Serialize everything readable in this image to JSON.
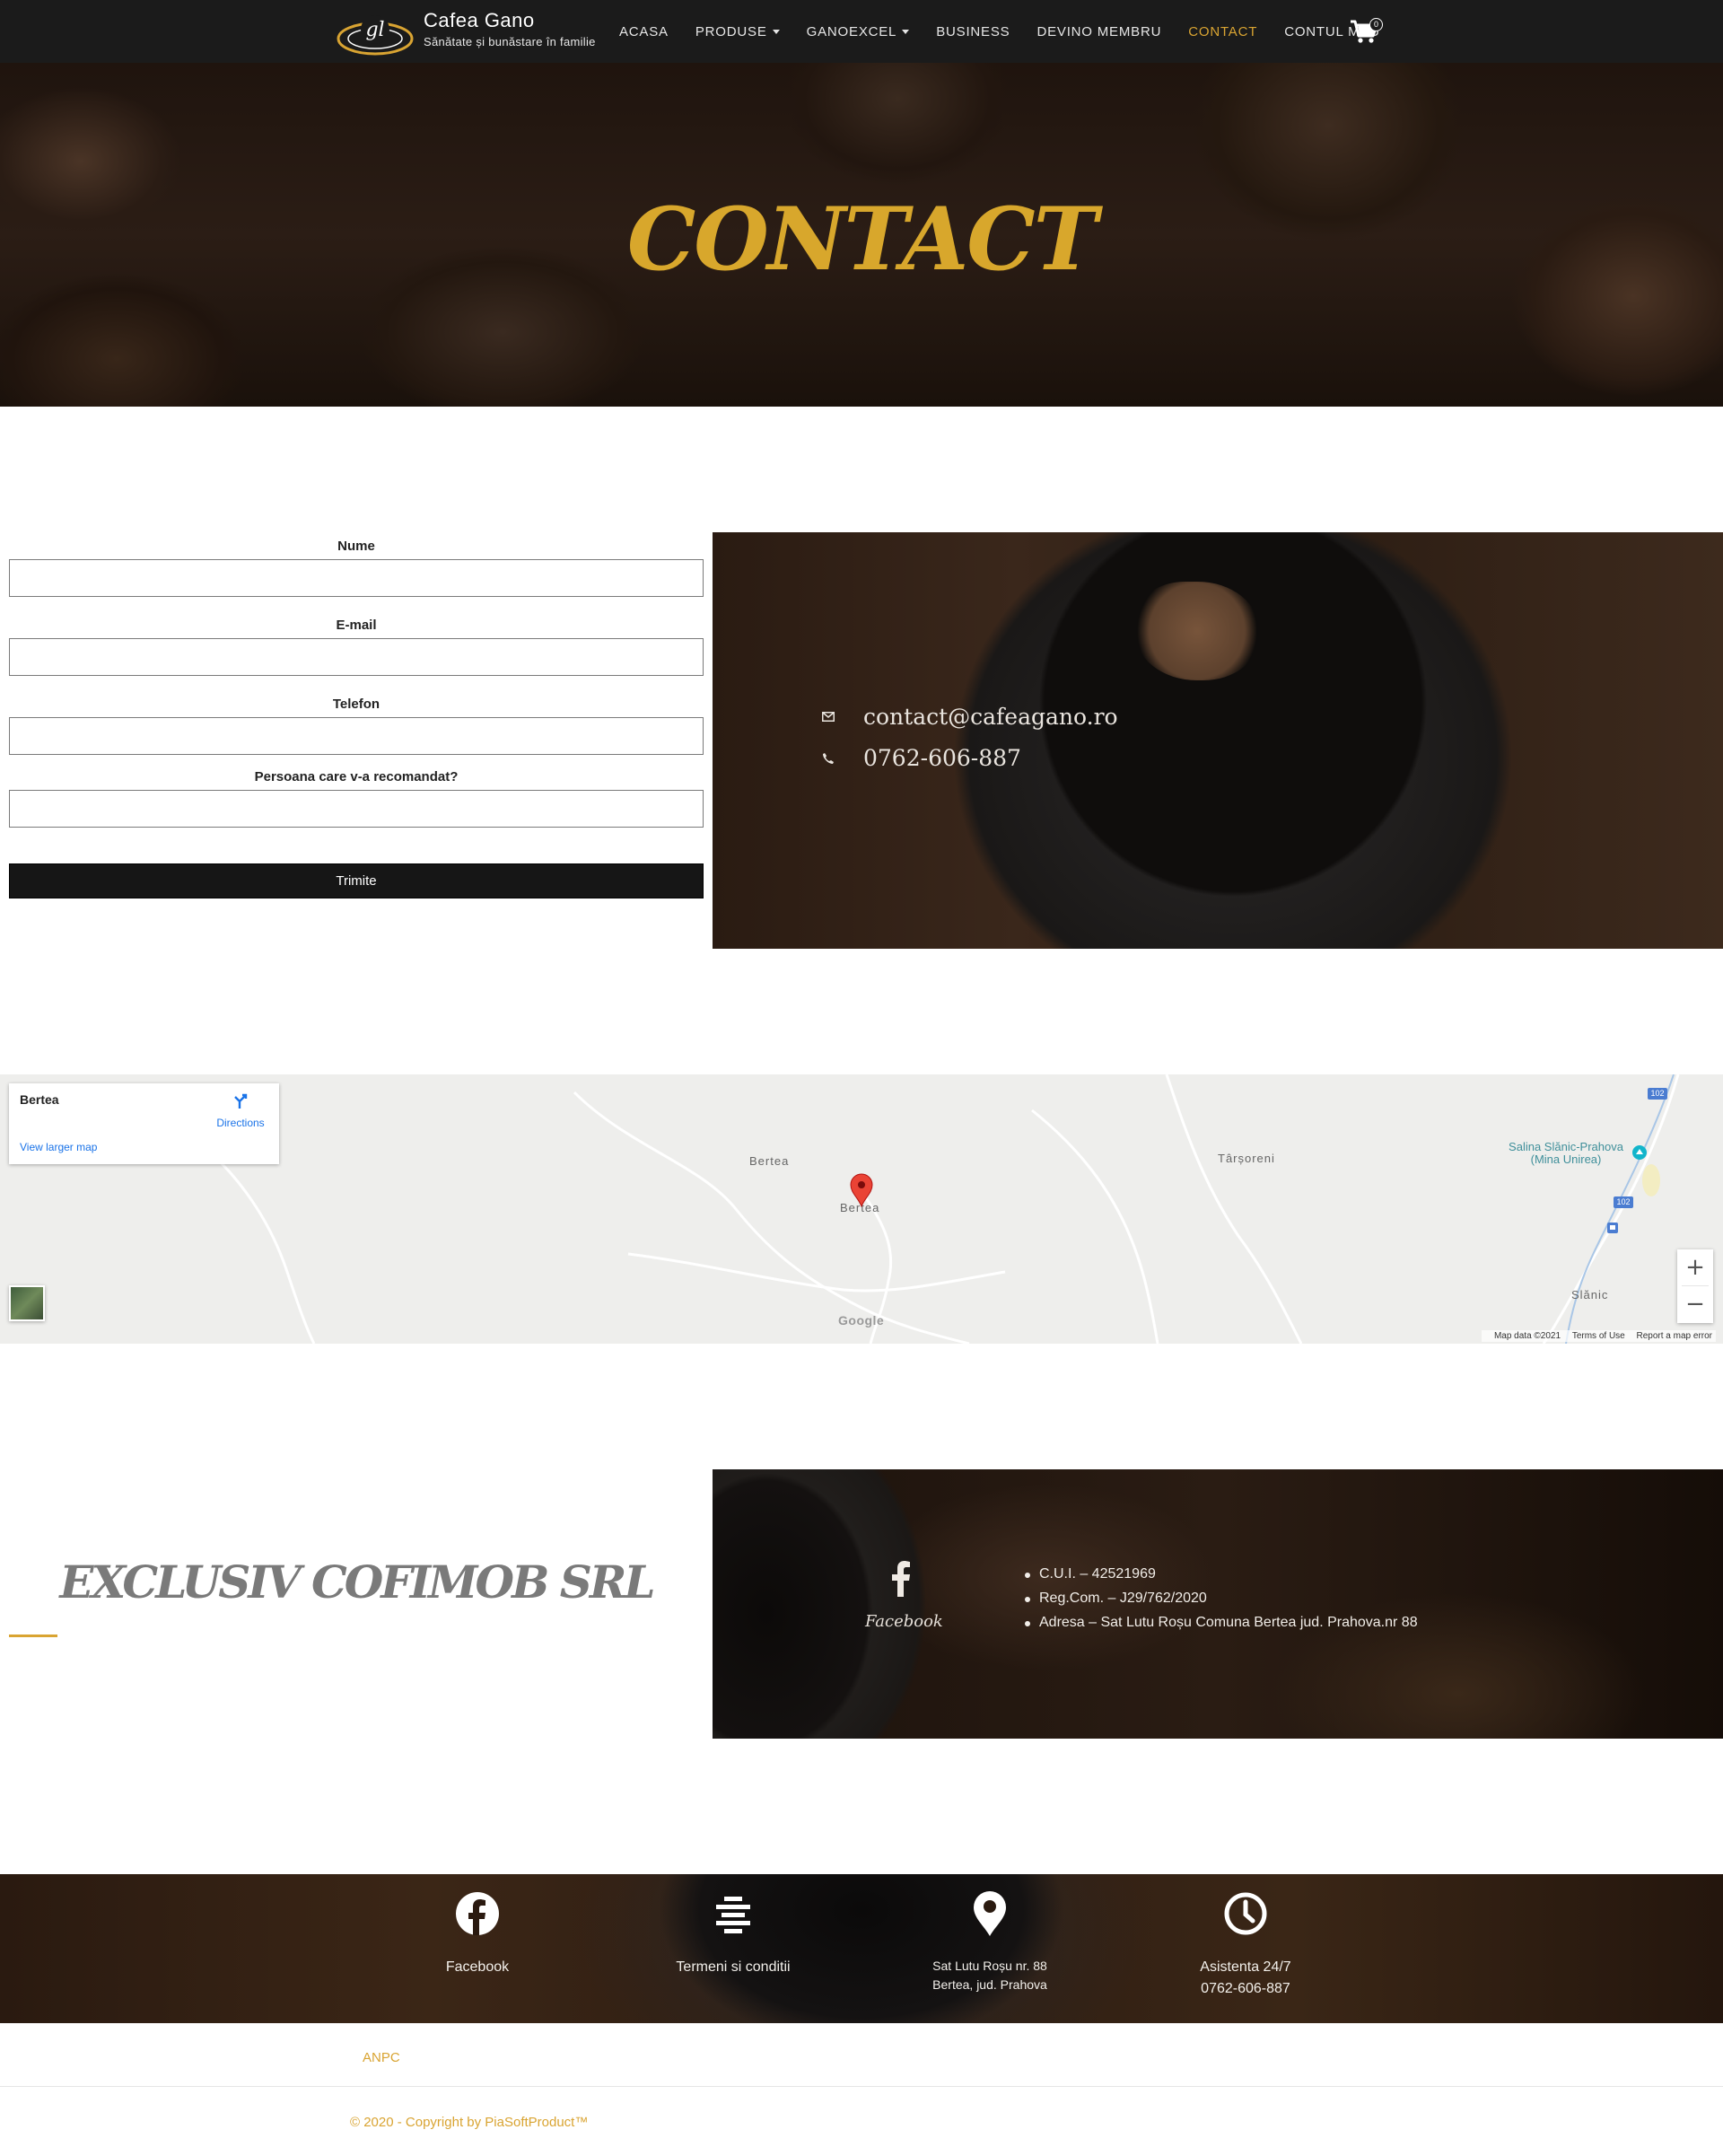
{
  "colors": {
    "accent": "#d9a432",
    "nav_bg": "#1b1b1b",
    "button_bg": "#161616"
  },
  "brand": {
    "logo_text": "gl",
    "name": "Cafea Gano",
    "tagline": "Sănătate și bunăstare în familie"
  },
  "nav": {
    "items": [
      {
        "label": "ACASA",
        "dropdown": false
      },
      {
        "label": "PRODUSE",
        "dropdown": true
      },
      {
        "label": "GANOEXCEL",
        "dropdown": true
      },
      {
        "label": "BUSINESS",
        "dropdown": false
      },
      {
        "label": "DEVINO MEMBRU",
        "dropdown": false
      },
      {
        "label": "CONTACT",
        "dropdown": false,
        "active": true
      },
      {
        "label": "CONTUL MEU",
        "dropdown": false
      }
    ],
    "cart_count": "0",
    "cart_icon": "shopping-cart-icon"
  },
  "hero": {
    "title": "CONTACT"
  },
  "form": {
    "fields": [
      {
        "label": "Nume",
        "value": "",
        "placeholder": ""
      },
      {
        "label": "E-mail",
        "value": "",
        "placeholder": ""
      },
      {
        "label": "Telefon",
        "value": "",
        "placeholder": ""
      },
      {
        "label": "Persoana care v-a recomandat?",
        "value": "",
        "placeholder": ""
      }
    ],
    "submit_label": "Trimite"
  },
  "contact": {
    "email": "contact@cafeagano.ro",
    "phone": "0762-606-887",
    "email_icon": "envelope-icon",
    "phone_icon": "phone-icon"
  },
  "map": {
    "card_title": "Bertea",
    "directions_label": "Directions",
    "larger_map_label": "View larger map",
    "places": [
      "Bertea",
      "Bertea",
      "Târșoreni",
      "Slănic"
    ],
    "poi": "Salina Slănic-Prahova (Mina Unirea)",
    "road_shields": [
      "102",
      "102"
    ],
    "google": "Google",
    "footer": {
      "data": "Map data ©2021",
      "terms": "Terms of Use",
      "report": "Report a map error"
    },
    "zoom_in": "+",
    "zoom_out": "−"
  },
  "company": {
    "title": "EXCLUSIV COFIMOB SRL",
    "facebook_label": "Facebook",
    "details": [
      "C.U.I. – 42521969",
      "Reg.Com. – J29/762/2020",
      "Adresa – Sat Lutu Roșu Comuna Bertea jud. Prahova.nr 88"
    ]
  },
  "footer_strip": {
    "items": [
      {
        "icon": "facebook-icon",
        "lines": [
          "Facebook"
        ]
      },
      {
        "icon": "terms-icon",
        "lines": [
          "Termeni si conditii"
        ]
      },
      {
        "icon": "location-pin-icon",
        "lines": [
          "Sat Lutu Roșu nr. 88",
          "Bertea, jud. Prahova"
        ]
      },
      {
        "icon": "clock-icon",
        "lines": [
          "Asistenta 24/7",
          "0762-606-887"
        ]
      }
    ]
  },
  "bottom": {
    "anpc": "ANPC",
    "copyright": "© 2020 - Copyright by PiaSoftProduct™"
  }
}
